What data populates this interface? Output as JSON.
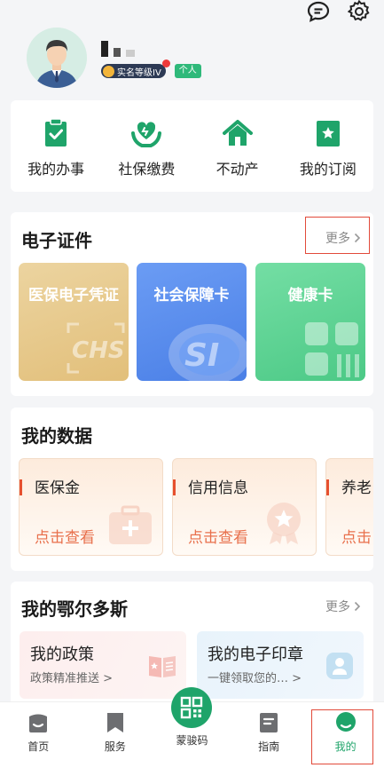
{
  "header": {
    "icons": [
      "message-icon",
      "settings-icon"
    ],
    "badge_level": "实名等级IV",
    "badge_type": "个人"
  },
  "quick_actions": [
    {
      "label": "我的办事",
      "icon": "clipboard-check-icon"
    },
    {
      "label": "社保缴费",
      "icon": "heart-hands-icon"
    },
    {
      "label": "不动产",
      "icon": "house-icon"
    },
    {
      "label": "我的订阅",
      "icon": "bookmark-star-icon"
    }
  ],
  "certs": {
    "title": "电子证件",
    "more": "更多",
    "items": [
      {
        "label": "医保电子凭证",
        "color": "#e6c98a"
      },
      {
        "label": "社会保障卡",
        "color": "#5a8ef0"
      },
      {
        "label": "健康卡",
        "color": "#5fd493"
      }
    ]
  },
  "mydata": {
    "title": "我的数据",
    "items": [
      {
        "label": "医保金",
        "action": "点击查看"
      },
      {
        "label": "信用信息",
        "action": "点击查看"
      },
      {
        "label": "养老",
        "action": "点击"
      }
    ]
  },
  "ordos": {
    "title": "我的鄂尔多斯",
    "more": "更多",
    "items": [
      {
        "title": "我的政策",
        "subtitle": "政策精准推送 >"
      },
      {
        "title": "我的电子印章",
        "subtitle": "一键领取您的… >"
      }
    ]
  },
  "tabbar": [
    {
      "label": "首页",
      "icon": "home-icon"
    },
    {
      "label": "服务",
      "icon": "bookmark-icon"
    },
    {
      "label": "蒙骏码",
      "icon": "qr-code-icon"
    },
    {
      "label": "指南",
      "icon": "guide-icon"
    },
    {
      "label": "我的",
      "icon": "user-icon"
    }
  ],
  "colors": {
    "accent": "#1fa46a",
    "highlight": "#e24a3a"
  }
}
